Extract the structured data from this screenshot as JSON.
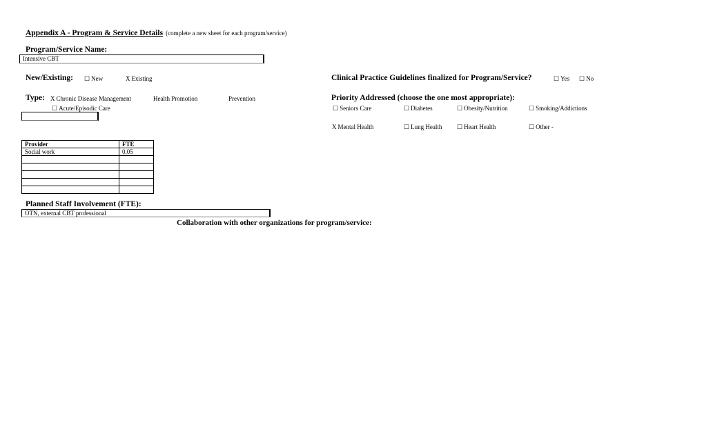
{
  "header": {
    "title": "Appendix A - Program & Service Details",
    "note": "(complete a new sheet for each program/service)"
  },
  "program_name": {
    "label": "Program/Service Name:",
    "value": "Intensive CBT"
  },
  "new_existing": {
    "label": "New/Existing:",
    "options": [
      {
        "label": "New",
        "checked": false,
        "mark": "☐"
      },
      {
        "label": "Existing",
        "checked": true,
        "mark": "X"
      }
    ]
  },
  "guidelines": {
    "label": "Clinical Practice Guidelines finalized for Program/Service?",
    "options": [
      {
        "label": "Yes",
        "checked": false,
        "mark": "☐"
      },
      {
        "label": "No",
        "checked": false,
        "mark": "☐"
      }
    ]
  },
  "type": {
    "label": "Type:",
    "options": [
      {
        "label": "Chronic Disease Management",
        "checked": true,
        "mark": "X"
      },
      {
        "label": "Health Promotion",
        "mark": ""
      },
      {
        "label": "Prevention",
        "mark": ""
      },
      {
        "label": "Acute/Episodic Care",
        "checked": false,
        "mark": "☐"
      }
    ],
    "other_value": ""
  },
  "priority": {
    "label": "Priority Addressed (choose the one most appropriate):",
    "options": [
      {
        "label": "Seniors Care",
        "checked": false,
        "mark": "☐"
      },
      {
        "label": "Diabetes",
        "checked": false,
        "mark": "☐"
      },
      {
        "label": "Obesity/Nutrition",
        "checked": false,
        "mark": "☐"
      },
      {
        "label": "Smoking/Addictions",
        "checked": false,
        "mark": "☐"
      },
      {
        "label": "Mental Health",
        "checked": true,
        "mark": "X"
      },
      {
        "label": "Lung Health",
        "checked": false,
        "mark": "☐"
      },
      {
        "label": "Heart Health",
        "checked": false,
        "mark": "☐"
      },
      {
        "label": "Other -",
        "checked": false,
        "mark": "☐"
      }
    ]
  },
  "staff": {
    "columns": [
      "Provider",
      "FTE"
    ],
    "rows": [
      [
        "Social work",
        "0.05"
      ],
      [
        "",
        ""
      ],
      [
        "",
        ""
      ],
      [
        "",
        ""
      ],
      [
        "",
        ""
      ],
      [
        "",
        ""
      ]
    ],
    "label": "Planned Staff Involvement (FTE):",
    "value": "OTN, external CBT professional"
  },
  "collaboration": {
    "label": "Collaboration with other organizations for program/service:"
  }
}
